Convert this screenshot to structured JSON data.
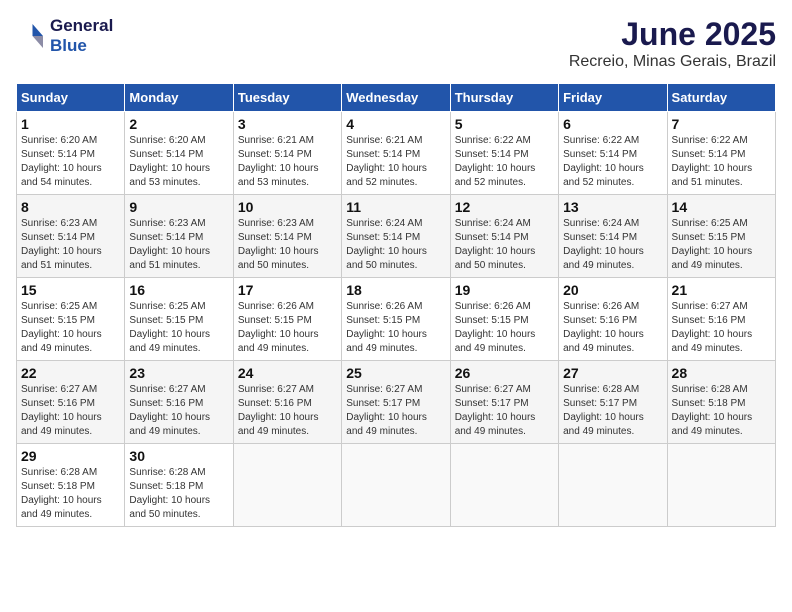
{
  "logo": {
    "line1": "General",
    "line2": "Blue"
  },
  "title": "June 2025",
  "location": "Recreio, Minas Gerais, Brazil",
  "weekdays": [
    "Sunday",
    "Monday",
    "Tuesday",
    "Wednesday",
    "Thursday",
    "Friday",
    "Saturday"
  ],
  "weeks": [
    [
      {
        "day": "1",
        "info": "Sunrise: 6:20 AM\nSunset: 5:14 PM\nDaylight: 10 hours\nand 54 minutes."
      },
      {
        "day": "2",
        "info": "Sunrise: 6:20 AM\nSunset: 5:14 PM\nDaylight: 10 hours\nand 53 minutes."
      },
      {
        "day": "3",
        "info": "Sunrise: 6:21 AM\nSunset: 5:14 PM\nDaylight: 10 hours\nand 53 minutes."
      },
      {
        "day": "4",
        "info": "Sunrise: 6:21 AM\nSunset: 5:14 PM\nDaylight: 10 hours\nand 52 minutes."
      },
      {
        "day": "5",
        "info": "Sunrise: 6:22 AM\nSunset: 5:14 PM\nDaylight: 10 hours\nand 52 minutes."
      },
      {
        "day": "6",
        "info": "Sunrise: 6:22 AM\nSunset: 5:14 PM\nDaylight: 10 hours\nand 52 minutes."
      },
      {
        "day": "7",
        "info": "Sunrise: 6:22 AM\nSunset: 5:14 PM\nDaylight: 10 hours\nand 51 minutes."
      }
    ],
    [
      {
        "day": "8",
        "info": "Sunrise: 6:23 AM\nSunset: 5:14 PM\nDaylight: 10 hours\nand 51 minutes."
      },
      {
        "day": "9",
        "info": "Sunrise: 6:23 AM\nSunset: 5:14 PM\nDaylight: 10 hours\nand 51 minutes."
      },
      {
        "day": "10",
        "info": "Sunrise: 6:23 AM\nSunset: 5:14 PM\nDaylight: 10 hours\nand 50 minutes."
      },
      {
        "day": "11",
        "info": "Sunrise: 6:24 AM\nSunset: 5:14 PM\nDaylight: 10 hours\nand 50 minutes."
      },
      {
        "day": "12",
        "info": "Sunrise: 6:24 AM\nSunset: 5:14 PM\nDaylight: 10 hours\nand 50 minutes."
      },
      {
        "day": "13",
        "info": "Sunrise: 6:24 AM\nSunset: 5:14 PM\nDaylight: 10 hours\nand 49 minutes."
      },
      {
        "day": "14",
        "info": "Sunrise: 6:25 AM\nSunset: 5:15 PM\nDaylight: 10 hours\nand 49 minutes."
      }
    ],
    [
      {
        "day": "15",
        "info": "Sunrise: 6:25 AM\nSunset: 5:15 PM\nDaylight: 10 hours\nand 49 minutes."
      },
      {
        "day": "16",
        "info": "Sunrise: 6:25 AM\nSunset: 5:15 PM\nDaylight: 10 hours\nand 49 minutes."
      },
      {
        "day": "17",
        "info": "Sunrise: 6:26 AM\nSunset: 5:15 PM\nDaylight: 10 hours\nand 49 minutes."
      },
      {
        "day": "18",
        "info": "Sunrise: 6:26 AM\nSunset: 5:15 PM\nDaylight: 10 hours\nand 49 minutes."
      },
      {
        "day": "19",
        "info": "Sunrise: 6:26 AM\nSunset: 5:15 PM\nDaylight: 10 hours\nand 49 minutes."
      },
      {
        "day": "20",
        "info": "Sunrise: 6:26 AM\nSunset: 5:16 PM\nDaylight: 10 hours\nand 49 minutes."
      },
      {
        "day": "21",
        "info": "Sunrise: 6:27 AM\nSunset: 5:16 PM\nDaylight: 10 hours\nand 49 minutes."
      }
    ],
    [
      {
        "day": "22",
        "info": "Sunrise: 6:27 AM\nSunset: 5:16 PM\nDaylight: 10 hours\nand 49 minutes."
      },
      {
        "day": "23",
        "info": "Sunrise: 6:27 AM\nSunset: 5:16 PM\nDaylight: 10 hours\nand 49 minutes."
      },
      {
        "day": "24",
        "info": "Sunrise: 6:27 AM\nSunset: 5:16 PM\nDaylight: 10 hours\nand 49 minutes."
      },
      {
        "day": "25",
        "info": "Sunrise: 6:27 AM\nSunset: 5:17 PM\nDaylight: 10 hours\nand 49 minutes."
      },
      {
        "day": "26",
        "info": "Sunrise: 6:27 AM\nSunset: 5:17 PM\nDaylight: 10 hours\nand 49 minutes."
      },
      {
        "day": "27",
        "info": "Sunrise: 6:28 AM\nSunset: 5:17 PM\nDaylight: 10 hours\nand 49 minutes."
      },
      {
        "day": "28",
        "info": "Sunrise: 6:28 AM\nSunset: 5:18 PM\nDaylight: 10 hours\nand 49 minutes."
      }
    ],
    [
      {
        "day": "29",
        "info": "Sunrise: 6:28 AM\nSunset: 5:18 PM\nDaylight: 10 hours\nand 49 minutes."
      },
      {
        "day": "30",
        "info": "Sunrise: 6:28 AM\nSunset: 5:18 PM\nDaylight: 10 hours\nand 50 minutes."
      },
      {
        "day": "",
        "info": ""
      },
      {
        "day": "",
        "info": ""
      },
      {
        "day": "",
        "info": ""
      },
      {
        "day": "",
        "info": ""
      },
      {
        "day": "",
        "info": ""
      }
    ]
  ]
}
